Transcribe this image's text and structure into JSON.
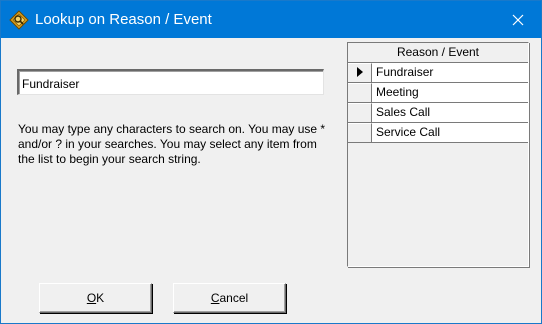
{
  "window": {
    "title": "Lookup on Reason / Event",
    "app_icon": "lookup-diamond-icon",
    "close_icon": "close-icon",
    "titlebar_color": "#0078d7"
  },
  "search": {
    "value": "Fundraiser"
  },
  "help_text": "You may type any characters to search on. You may use * and/or ? in your searches. You may select any item from the list to begin your search string.",
  "grid": {
    "column_header": "Reason / Event",
    "current_row_index": 0,
    "rows": [
      {
        "label": "Fundraiser",
        "current": true
      },
      {
        "label": "Meeting",
        "current": false
      },
      {
        "label": "Sales Call",
        "current": false
      },
      {
        "label": "Service Call",
        "current": false
      }
    ]
  },
  "buttons": {
    "ok": {
      "mnemonic": "O",
      "rest": "K"
    },
    "cancel": {
      "mnemonic": "C",
      "rest": "ancel"
    }
  }
}
